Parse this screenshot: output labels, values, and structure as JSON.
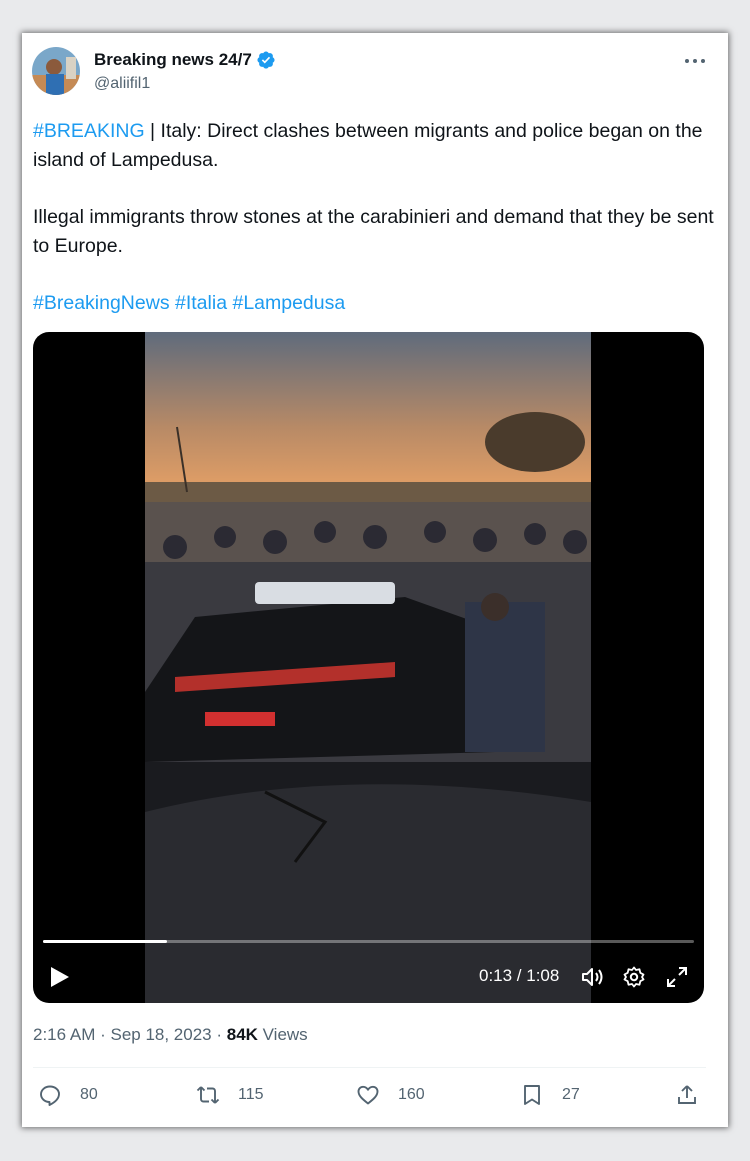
{
  "tweet": {
    "author": {
      "display_name": "Breaking news 24/7",
      "handle": "@aliifil1",
      "verified": true
    },
    "text": {
      "line1_hashtag": "#BREAKING",
      "line1_rest": " | Italy: Direct clashes between migrants and police began on the island of Lampedusa.",
      "line2": "Illegal immigrants throw stones at the carabinieri and demand that they be sent to Europe.",
      "hashtags": [
        "#BreakingNews",
        "#Italia",
        "#Lampedusa"
      ]
    },
    "video": {
      "time_display": "0:13 / 1:08",
      "progress_fraction": 0.191
    },
    "meta": {
      "timestamp": "2:16 AM · Sep 18, 2023 · ",
      "views_count": "84K",
      "views_label": " Views"
    },
    "actions": {
      "replies": "80",
      "reposts": "115",
      "likes": "160",
      "bookmarks": "27"
    }
  },
  "colors": {
    "link": "#1d9bf0",
    "secondary_text": "#536471",
    "primary_text": "#0f1419"
  }
}
